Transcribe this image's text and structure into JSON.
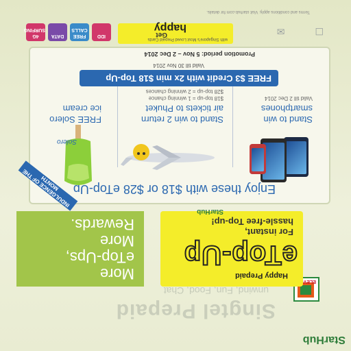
{
  "logos": {
    "starhub": "StarHub",
    "seven_eleven": "ELEVEN"
  },
  "background": {
    "singtel": "Singtel Prepaid",
    "singtel_sub": "unwind, Fun, Food, Chat"
  },
  "rewards": {
    "line1": "More",
    "line2": "eTop-Ups,",
    "line3": "More",
    "line4": "Rewards."
  },
  "etopup": {
    "brand": "Happy Prepaid",
    "word": "eTop-Up",
    "line1": "For instant,",
    "line2": "hassle-free Top-up!",
    "starhub": "StarHub"
  },
  "promo": {
    "title": "Enjoy these with $18 or $28 eTop-Up",
    "ribbon": "INDULGENCE OF THE MONTH",
    "prizes": [
      {
        "head1": "Stand to win",
        "head2": "smartphones",
        "small": "Valid till 2 Dec 2014"
      },
      {
        "head1": "Stand to win 2 return",
        "head2": "air tickets to Phuket",
        "small1": "$18 top-up = 1 winning chance",
        "small2": "$28 top-up = 2 winning chances"
      },
      {
        "head1": "FREE Solero",
        "head2": "ice cream",
        "brand": "Solero"
      }
    ],
    "credit": "FREE $3 Credit with 2x min $18 Top-Up",
    "credit_valid": "Valid till 30 Nov 2014",
    "period": "Promotion period: 5 Nov – 2 Dec 2014"
  },
  "happy_strip": {
    "get": "Get",
    "happy": "happy",
    "small": "with Singapore's Most Loved Prepaid Cards",
    "tiles": [
      {
        "label": "4G SURFING",
        "color": "#d1376a"
      },
      {
        "label": "DATA",
        "color": "#7a4aa8"
      },
      {
        "label": "FREE CALLS",
        "color": "#3a8bc9"
      },
      {
        "label": "IDD",
        "color": "#d1376a"
      }
    ]
  },
  "footer": {
    "fine": "Terms and conditions apply. Visit starhub.com for details."
  },
  "colors": {
    "green": "#a2c54a",
    "yellow": "#f4ed2a",
    "blue": "#2b68b0"
  }
}
